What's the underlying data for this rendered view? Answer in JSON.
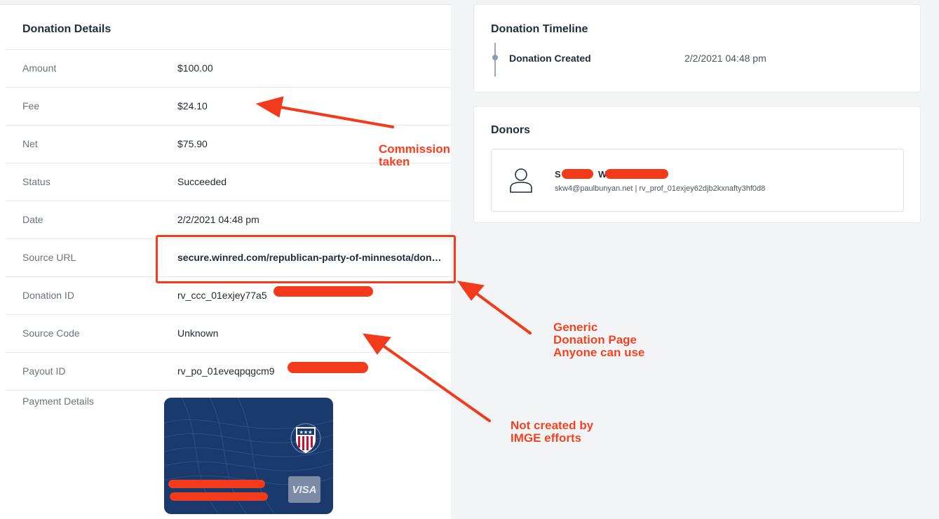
{
  "details": {
    "title": "Donation Details",
    "rows": [
      {
        "label": "Amount",
        "value": "$100.00"
      },
      {
        "label": "Fee",
        "value": "$24.10"
      },
      {
        "label": "Net",
        "value": "$75.90"
      },
      {
        "label": "Status",
        "value": "Succeeded"
      },
      {
        "label": "Date",
        "value": "2/2/2021 04:48 pm"
      },
      {
        "label": "Source URL",
        "value": "secure.winred.com/republican-party-of-minnesota/don…"
      },
      {
        "label": "Donation ID",
        "value": "rv_ccc_01exjey77a5"
      },
      {
        "label": "Source Code",
        "value": "Unknown"
      },
      {
        "label": "Payout ID",
        "value": "rv_po_01eveqpqgcm9"
      }
    ],
    "payment_label": "Payment Details",
    "card_brand": "VISA"
  },
  "timeline": {
    "title": "Donation Timeline",
    "event": "Donation Created",
    "date": "2/2/2021 04:48 pm"
  },
  "donors": {
    "title": "Donors",
    "name_first_initial": "S",
    "name_last_initial": "W",
    "subtitle": "skw4@paulbunyan.net | rv_prof_01exjey62djb2kxnafty3hf0d8",
    "icon": "user-icon"
  },
  "annotations": {
    "commission": [
      "Commission",
      "taken"
    ],
    "generic": [
      "Generic",
      "Donation Page",
      "Anyone can use"
    ],
    "not_created": [
      "Not created by",
      "IMGE efforts"
    ],
    "color": "#ff3b1c"
  }
}
